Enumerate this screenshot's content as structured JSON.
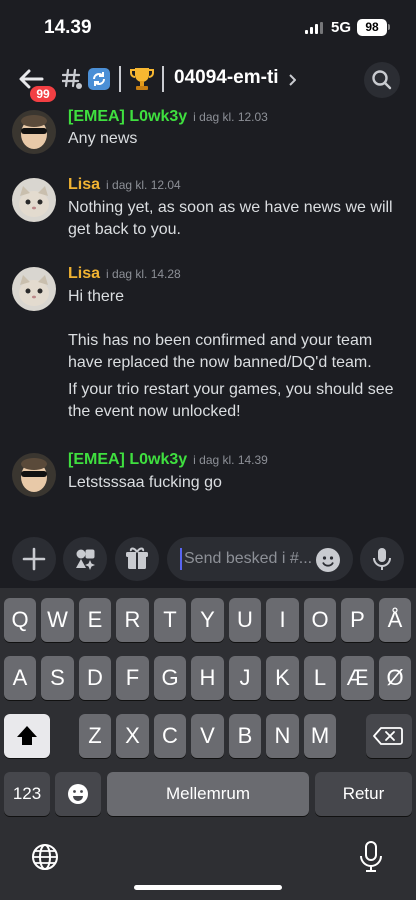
{
  "status": {
    "time": "14.39",
    "network": "5G",
    "battery": "98"
  },
  "header": {
    "badge": "99",
    "channel": "04094-em-ti"
  },
  "messages": [
    {
      "author": "[EMEA] L0wk3y",
      "time": "i dag kl. 12.03",
      "text": "Any news",
      "color": "#3fdf3f"
    },
    {
      "author": "Lisa",
      "time": "i dag kl. 12.04",
      "lines": [
        "Nothing yet, as soon as we have news we will",
        "get back to you."
      ],
      "color": "#f0b232"
    },
    {
      "author": "Lisa",
      "time": "i dag kl. 14.28",
      "lines": [
        "Hi there",
        "This has no been confirmed and your team",
        "have replaced the now banned/DQ'd team.",
        "If your trio restart your games, you should see",
        "the event now unlocked!"
      ],
      "color": "#f0b232"
    },
    {
      "author": "[EMEA] L0wk3y",
      "time": "i dag kl. 14.39",
      "text": "Letstsssaa fucking go",
      "color": "#3fdf3f"
    }
  ],
  "composer": {
    "placeholder": "Send besked i #..."
  },
  "keyboard": {
    "row1": [
      "Q",
      "W",
      "E",
      "R",
      "T",
      "Y",
      "U",
      "I",
      "O",
      "P",
      "Å"
    ],
    "row2": [
      "A",
      "S",
      "D",
      "F",
      "G",
      "H",
      "J",
      "K",
      "L",
      "Æ",
      "Ø"
    ],
    "row3": [
      "Z",
      "X",
      "C",
      "V",
      "B",
      "N",
      "M"
    ],
    "numbers": "123",
    "space": "Mellemrum",
    "return": "Retur"
  },
  "icons": [
    "back-arrow-icon",
    "hash-icon",
    "refresh-icon",
    "trophy-icon",
    "chevron-right-icon",
    "search-icon",
    "plus-icon",
    "apps-icon",
    "gift-icon",
    "emoji-icon",
    "microphone-icon",
    "shift-icon",
    "backspace-icon",
    "globe-icon"
  ]
}
